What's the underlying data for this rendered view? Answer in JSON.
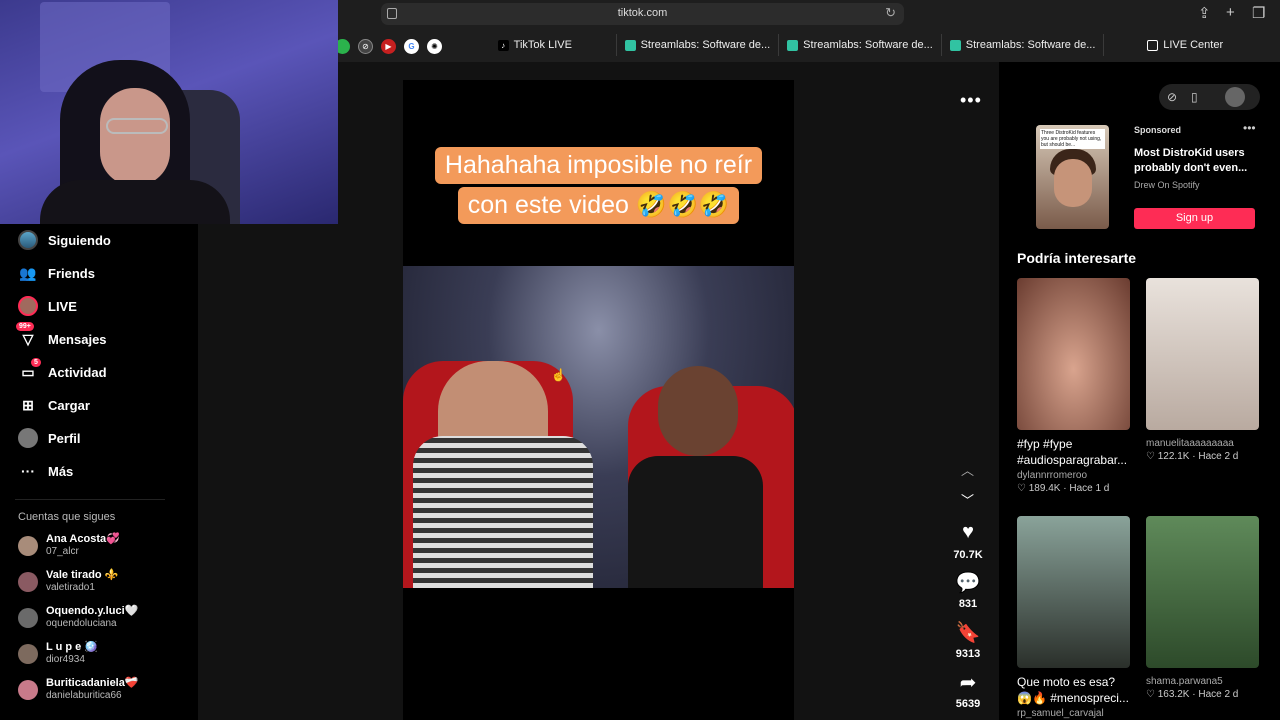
{
  "browser": {
    "url": "tiktok.com",
    "tabs": [
      {
        "label": "TikTok LIVE"
      },
      {
        "label": "Streamlabs: Software de..."
      },
      {
        "label": "Streamlabs: Software de..."
      },
      {
        "label": "Streamlabs: Software de..."
      },
      {
        "label": "LIVE Center"
      }
    ]
  },
  "sidebar": {
    "items": [
      {
        "label": "Siguiendo",
        "icon": "following-avatar-icon"
      },
      {
        "label": "Friends",
        "icon": "friends-icon"
      },
      {
        "label": "LIVE",
        "icon": "live-avatar-icon"
      },
      {
        "label": "Mensajes",
        "icon": "messages-icon",
        "badge": "99+"
      },
      {
        "label": "Actividad",
        "icon": "activity-icon",
        "badge": "5"
      },
      {
        "label": "Cargar",
        "icon": "upload-icon"
      },
      {
        "label": "Perfil",
        "icon": "profile-avatar-icon"
      },
      {
        "label": "Más",
        "icon": "more-icon"
      }
    ],
    "following_label": "Cuentas que sigues",
    "following": [
      {
        "name": "Ana Acosta💞",
        "handle": "07_alcr",
        "color": "#a88c7a"
      },
      {
        "name": "Vale tirado ⚜️",
        "handle": "valetirado1",
        "color": "#8a5a62"
      },
      {
        "name": "Oquendo.y.luci🤍",
        "handle": "oquendoluciana",
        "color": "#6a6a6a"
      },
      {
        "name": "L u p e 🪩",
        "handle": "dior4934",
        "color": "#7d6a5e"
      },
      {
        "name": "Buriticadaniela❤️‍🩹",
        "handle": "danielaburitica66",
        "color": "#c87a8a"
      }
    ]
  },
  "video": {
    "caption_line1": "Hahahaha imposible no reír",
    "caption_line2": "con este video 🤣🤣🤣",
    "likes": "70.7K",
    "comments": "831",
    "saves": "9313",
    "shares": "5639"
  },
  "ad": {
    "sponsored_label": "Sponsored",
    "title": "Most DistroKid users probably don't even...",
    "subtitle": "Drew On Spotify",
    "cta": "Sign up",
    "thumb_text": "Three DistroKid features you are probably not using, but should be..."
  },
  "recommendations": {
    "title": "Podría interesarte",
    "cards": [
      {
        "title": "#fyp #fype #audiosparagrabar...",
        "author": "dylannrromeroo",
        "likes": "189.4K",
        "age": "Hace 1 d"
      },
      {
        "title": "",
        "author": "manuelitaaaaaaaaa",
        "likes": "122.1K",
        "age": "Hace 2 d"
      },
      {
        "title": "Que moto es esa? 😱🔥 #menospreci...",
        "author": "rp_samuel_carvajal",
        "likes": "",
        "age": ""
      },
      {
        "title": "",
        "author": "shama.parwana5",
        "likes": "163.2K",
        "age": "Hace 2 d"
      }
    ]
  },
  "colors": {
    "accent": "#fe2c55",
    "caption_bg": "#f39a5a"
  }
}
